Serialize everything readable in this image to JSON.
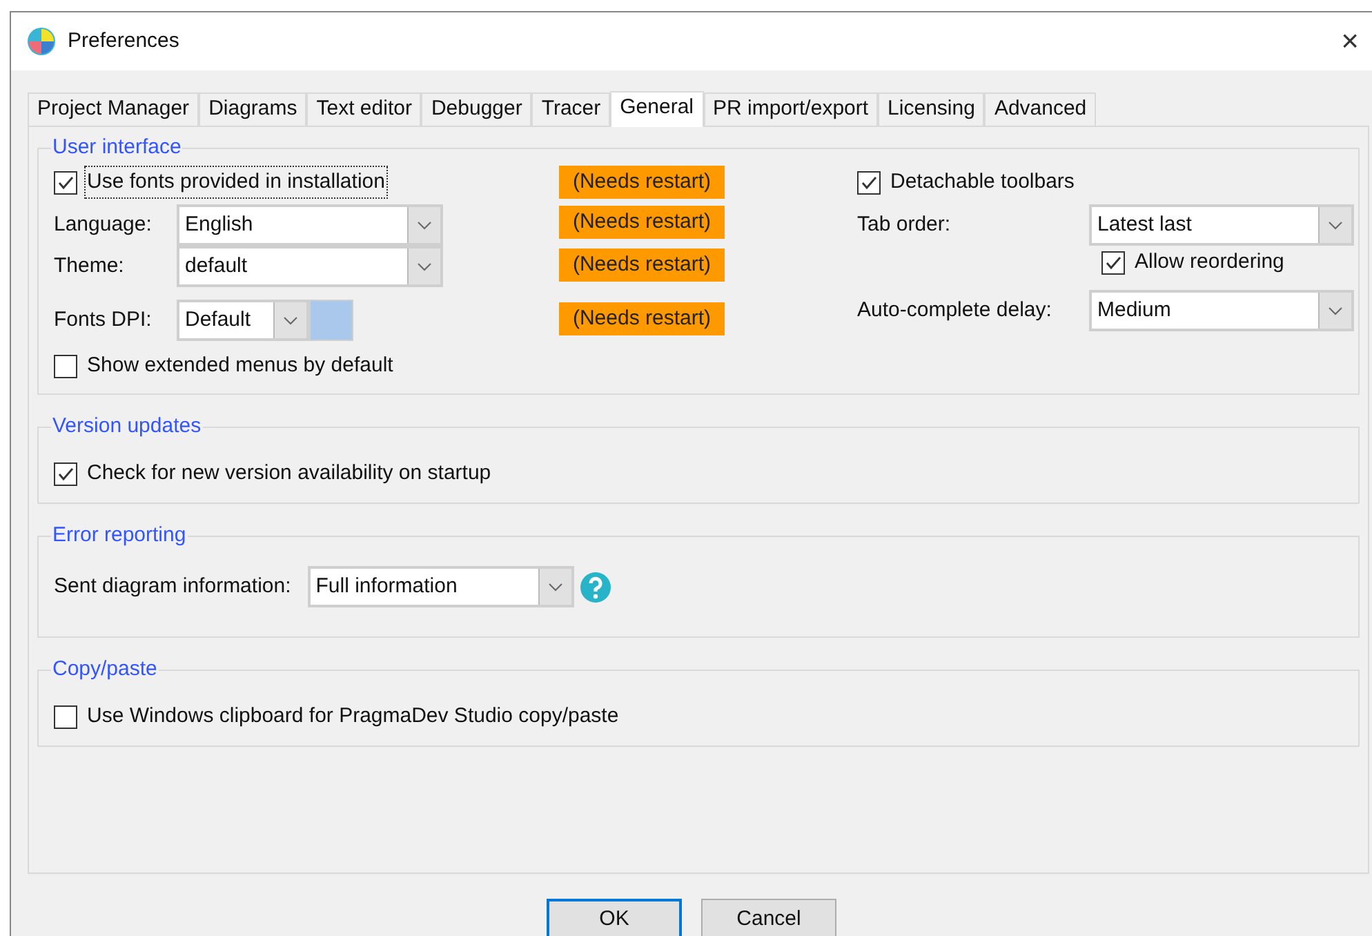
{
  "window": {
    "title": "Preferences",
    "close": "×"
  },
  "tabs": [
    {
      "label": "Project Manager",
      "selected": false
    },
    {
      "label": "Diagrams",
      "selected": false
    },
    {
      "label": "Text editor",
      "selected": false
    },
    {
      "label": "Debugger",
      "selected": false
    },
    {
      "label": "Tracer",
      "selected": false
    },
    {
      "label": "General",
      "selected": true
    },
    {
      "label": "PR import/export",
      "selected": false
    },
    {
      "label": "Licensing",
      "selected": false
    },
    {
      "label": "Advanced",
      "selected": false
    }
  ],
  "user_interface": {
    "title": "User interface",
    "use_fonts": {
      "label": "Use fonts provided in installation",
      "checked": true,
      "focused": true
    },
    "language": {
      "label": "Language:",
      "value": "English"
    },
    "theme": {
      "label": "Theme:",
      "value": "default"
    },
    "fonts_dpi": {
      "label": "Fonts DPI:",
      "value": "Default"
    },
    "show_extended_menus": {
      "label": "Show extended menus by default",
      "checked": false,
      "focused": false
    },
    "restart_notes": [
      "(Needs restart)",
      "(Needs restart)",
      "(Needs restart)",
      "(Needs restart)"
    ],
    "detachable_toolbars": {
      "label": "Detachable toolbars",
      "checked": true,
      "focused": false
    },
    "tab_order": {
      "label": "Tab order:",
      "value": "Latest last"
    },
    "allow_reordering": {
      "label": "Allow reordering",
      "checked": true,
      "focused": false
    },
    "auto_complete_delay": {
      "label": "Auto-complete delay:",
      "value": "Medium"
    }
  },
  "version_updates": {
    "title": "Version updates",
    "check_on_startup": {
      "label": "Check for new version availability on startup",
      "checked": true,
      "focused": false
    }
  },
  "error_reporting": {
    "title": "Error reporting",
    "sent_diagram_information": {
      "label": "Sent diagram information:",
      "value": "Full information"
    }
  },
  "copy_paste": {
    "title": "Copy/paste",
    "use_windows_clipboard": {
      "label": "Use Windows clipboard for PragmaDev Studio copy/paste",
      "checked": false,
      "focused": false
    }
  },
  "buttons": [
    {
      "label": "OK",
      "default": true
    },
    {
      "label": "Cancel",
      "default": false
    }
  ]
}
